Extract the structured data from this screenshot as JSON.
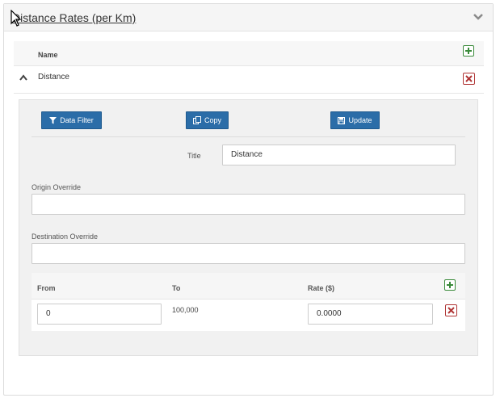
{
  "panel": {
    "title": "Distance Rates (per Km)"
  },
  "list": {
    "column_name": "Name",
    "rows": [
      {
        "name": "Distance"
      }
    ]
  },
  "detail": {
    "buttons": {
      "data_filter": "Data Filter",
      "copy": "Copy",
      "update": "Update"
    },
    "title_label": "Title",
    "title_value": "Distance",
    "origin_label": "Origin Override",
    "origin_value": "",
    "destination_label": "Destination Override",
    "destination_value": ""
  },
  "rates": {
    "headers": {
      "from": "From",
      "to": "To",
      "rate": "Rate ($)"
    },
    "rows": [
      {
        "from": "0",
        "to": "100,000",
        "rate": "0.0000"
      }
    ]
  },
  "colors": {
    "primary_button": "#2b6da8",
    "add_icon": "#3a8a3a",
    "delete_icon": "#b03535"
  }
}
